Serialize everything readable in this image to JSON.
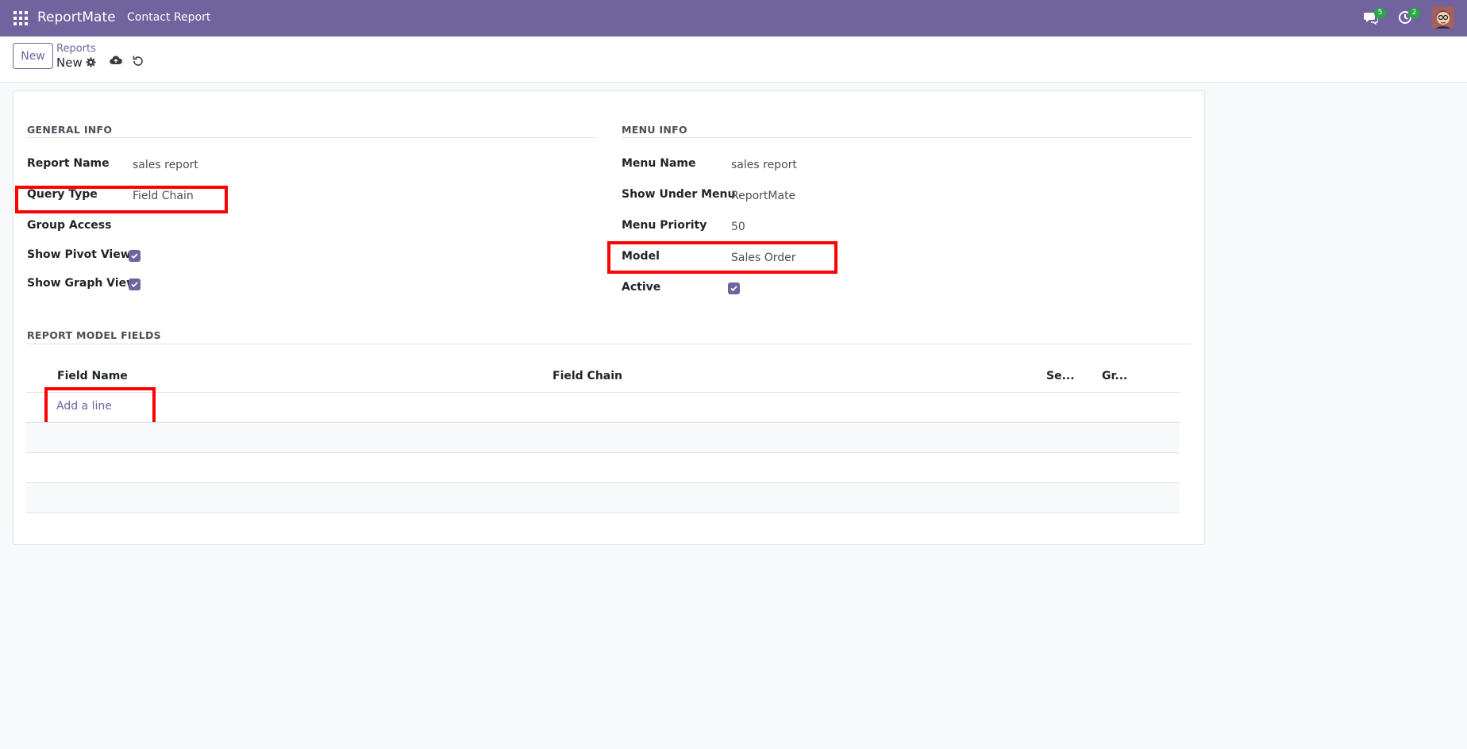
{
  "navbar": {
    "brand": "ReportMate",
    "menu_item": "Contact Report",
    "messages_count": "5",
    "activities_count": "2"
  },
  "control_panel": {
    "new_button": "New",
    "breadcrumb_parent": "Reports",
    "breadcrumb_current": "New"
  },
  "general_info": {
    "title": "GENERAL INFO",
    "report_name_label": "Report Name",
    "report_name_value": "sales report",
    "query_type_label": "Query Type",
    "query_type_value": "Field Chain",
    "group_access_label": "Group Access",
    "show_pivot_label": "Show Pivot View",
    "show_pivot_checked": true,
    "show_graph_label": "Show Graph View",
    "show_graph_checked": true
  },
  "menu_info": {
    "title": "MENU INFO",
    "menu_name_label": "Menu Name",
    "menu_name_value": "sales report",
    "show_under_label": "Show Under Menu",
    "show_under_value": "ReportMate",
    "priority_label": "Menu Priority",
    "priority_value": "50",
    "model_label": "Model",
    "model_value": "Sales Order",
    "active_label": "Active",
    "active_checked": true
  },
  "report_fields": {
    "title": "REPORT MODEL FIELDS",
    "columns": [
      "Field Name",
      "Field Chain",
      "Se...",
      "Gr..."
    ],
    "add_line": "Add a line"
  },
  "colors": {
    "brand": "#71639e",
    "highlight": "#ff0000",
    "badge": "#28a745"
  }
}
